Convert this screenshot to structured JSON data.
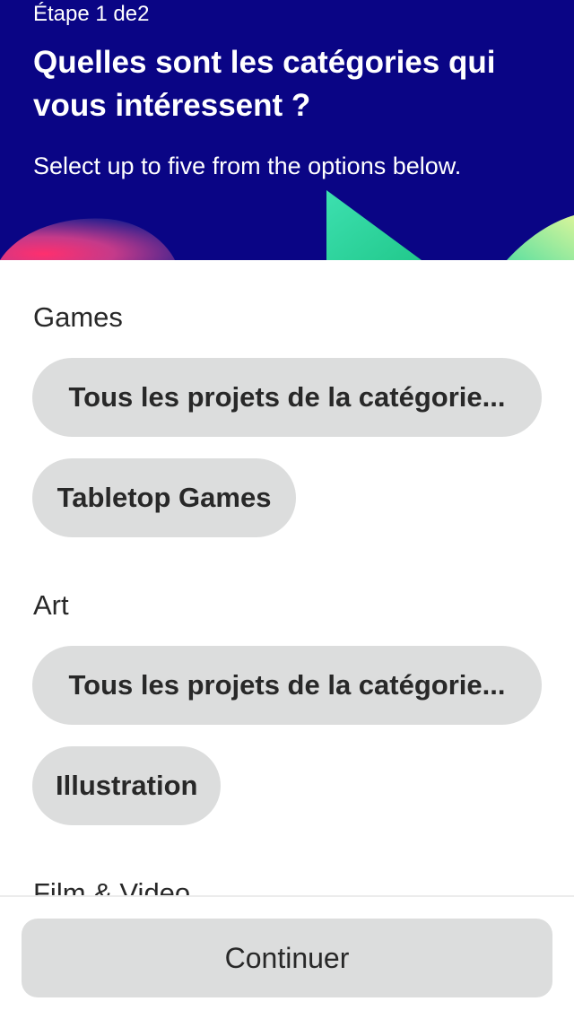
{
  "header": {
    "step": "Étape 1 de2",
    "title": "Quelles sont les catégories qui vous intéressent ?",
    "subtitle": "Select up to five from the options below."
  },
  "sections": [
    {
      "title": "Games",
      "chips": [
        "Tous les projets de la catégorie...",
        "Tabletop Games"
      ]
    },
    {
      "title": "Art",
      "chips": [
        "Tous les projets de la catégorie...",
        "Illustration"
      ]
    },
    {
      "title": "Film & Video",
      "chips": []
    }
  ],
  "footer": {
    "continue_label": "Continuer"
  },
  "colors": {
    "header_bg": "#0a0585",
    "chip_bg": "#dcdddd",
    "text": "#282828"
  }
}
